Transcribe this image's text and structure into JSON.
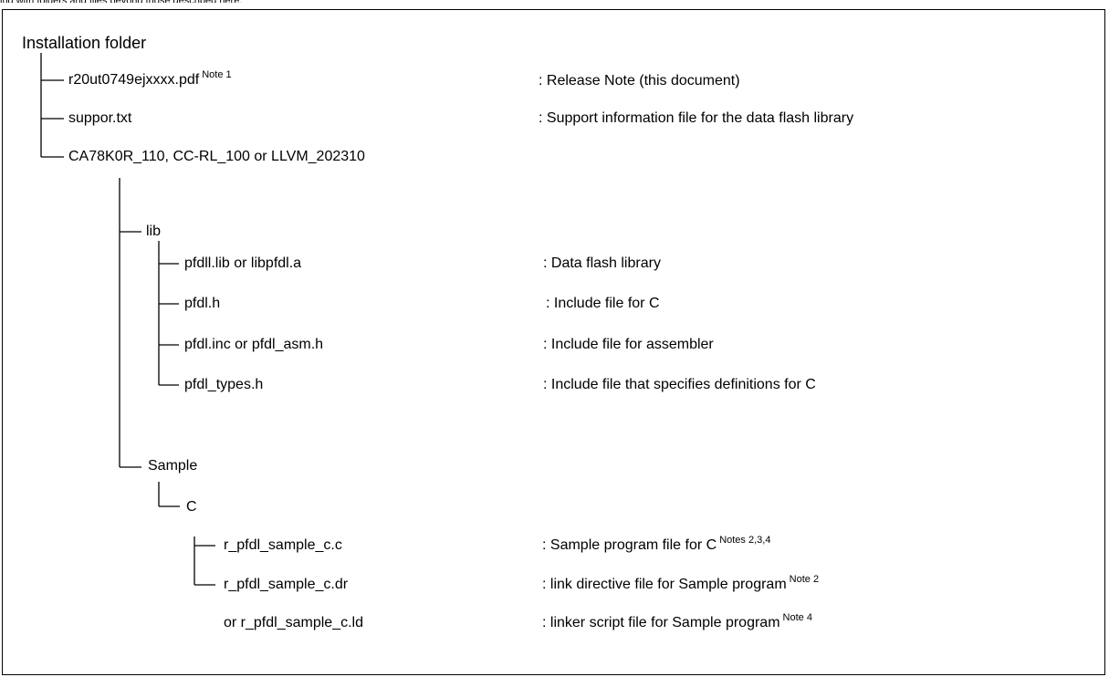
{
  "top_fragment": "ing with folders and files beyond those described here.",
  "root": "Installation folder",
  "items": [
    {
      "name": "r20ut0749ejxxxx.pdf",
      "note": "Note 1",
      "desc": ": Release Note (this document)",
      "desc_note": ""
    },
    {
      "name": "suppor.txt",
      "note": "",
      "desc": ": Support information file for the data flash library",
      "desc_note": ""
    },
    {
      "name": "CA78K0R_110, CC-RL_100 or LLVM_202310",
      "note": "",
      "desc": "",
      "desc_note": ""
    },
    {
      "name": "lib",
      "note": "",
      "desc": "",
      "desc_note": ""
    },
    {
      "name": "pfdll.lib or libpfdl.a",
      "note": "",
      "desc": ": Data flash library",
      "desc_note": ""
    },
    {
      "name": "pfdl.h",
      "note": "",
      "desc": ": Include file for C",
      "desc_note": ""
    },
    {
      "name": "pfdl.inc or pfdl_asm.h",
      "note": "",
      "desc": ": Include file for assembler",
      "desc_note": ""
    },
    {
      "name": "pfdl_types.h",
      "note": "",
      "desc": ": Include file that specifies definitions for C",
      "desc_note": ""
    },
    {
      "name": "Sample",
      "note": "",
      "desc": "",
      "desc_note": ""
    },
    {
      "name": "C",
      "note": "",
      "desc": "",
      "desc_note": ""
    },
    {
      "name": "r_pfdl_sample_c.c",
      "note": "",
      "desc": ": Sample program file for C",
      "desc_note": "Notes 2,3,4"
    },
    {
      "name": "r_pfdl_sample_c.dr",
      "note": "",
      "desc": ": link directive file for Sample program",
      "desc_note": "Note 2"
    },
    {
      "name": "or r_pfdl_sample_c.ld",
      "note": "",
      "desc": ": linker script file for Sample program",
      "desc_note": "Note 4"
    }
  ]
}
